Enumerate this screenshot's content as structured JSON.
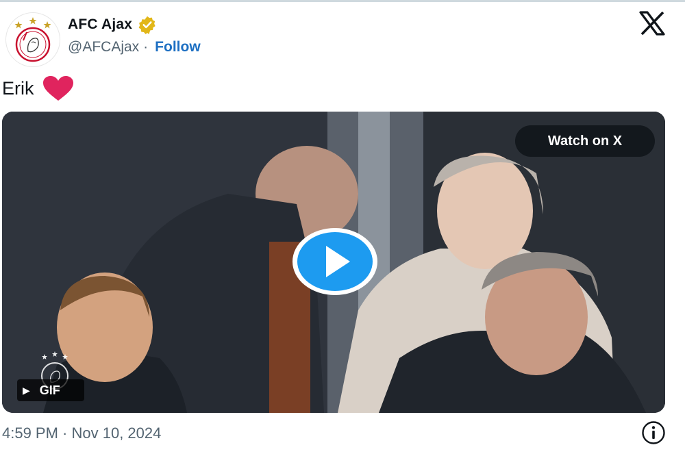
{
  "author": {
    "display_name": "AFC Ajax",
    "handle": "@AFCAjax",
    "separator": "·",
    "follow_label": "Follow",
    "verified_color": "#e2b719",
    "logo_text": "Ajax"
  },
  "tweet": {
    "text": "Erik",
    "emoji": "heart"
  },
  "media": {
    "watch_label": "Watch on X",
    "gif_label": "GIF",
    "gif_play_glyph": "▶",
    "play_button_color": "#1d9bf0"
  },
  "footer": {
    "timestamp": "4:59 PM · Nov 10, 2024"
  },
  "colors": {
    "accent": "#1d6fc2",
    "text": "#0f1419",
    "muted": "#536471"
  }
}
